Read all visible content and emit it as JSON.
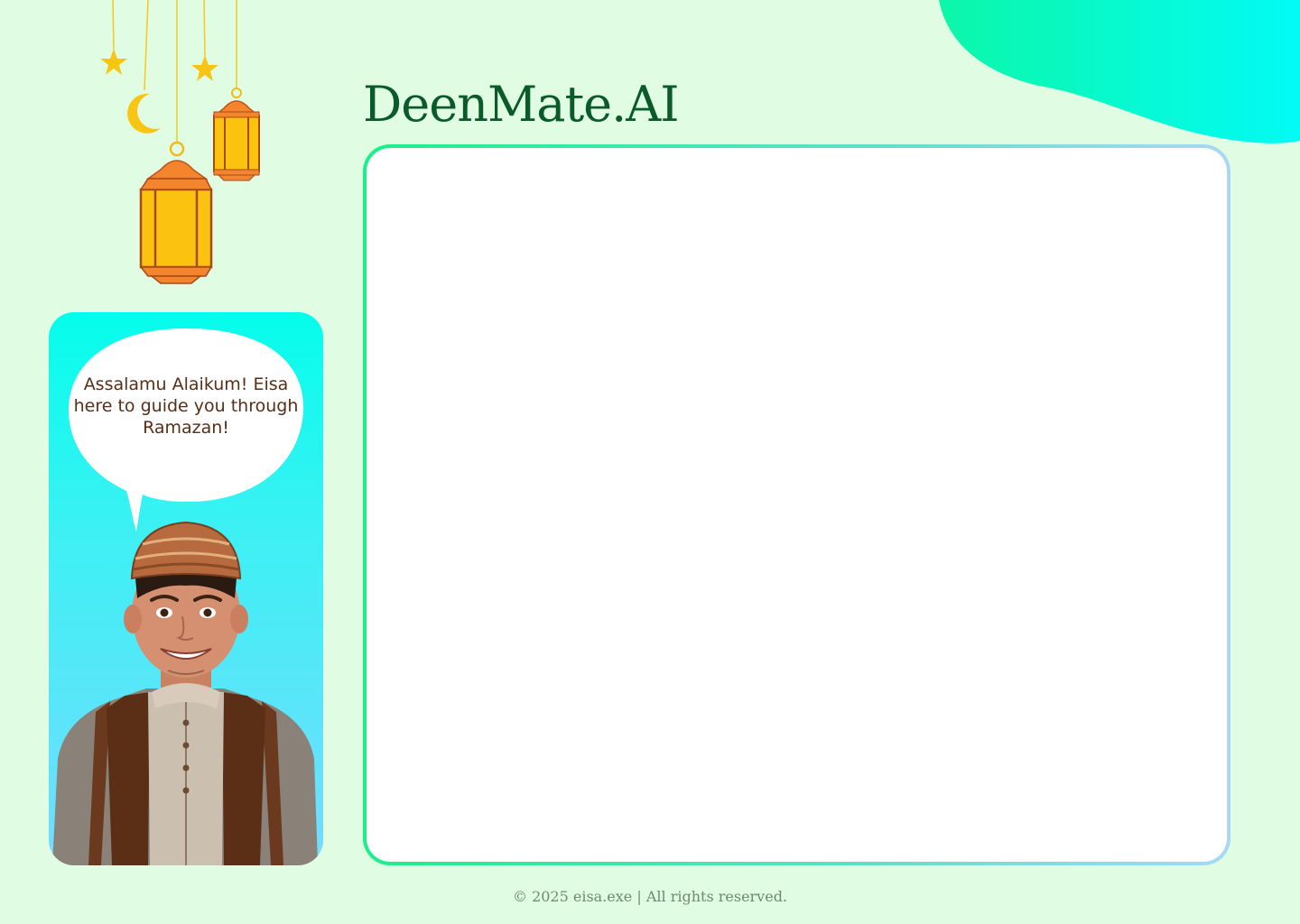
{
  "header": {
    "app_title": "DeenMate.AI"
  },
  "mascot": {
    "greeting": "Assalamu Alaikum! Eisa here to guide you through Ramazan!"
  },
  "footer": {
    "copyright": "© 2025 eisa.exe | All rights reserved."
  },
  "colors": {
    "background": "#e0fde4",
    "title": "#0b5a2a",
    "accent_green": "#19f08a",
    "accent_cyan": "#04fdec",
    "speech_text": "#5a2e17"
  },
  "icons": [
    "hanging-star-icon",
    "crescent-moon-icon",
    "lantern-icon"
  ]
}
